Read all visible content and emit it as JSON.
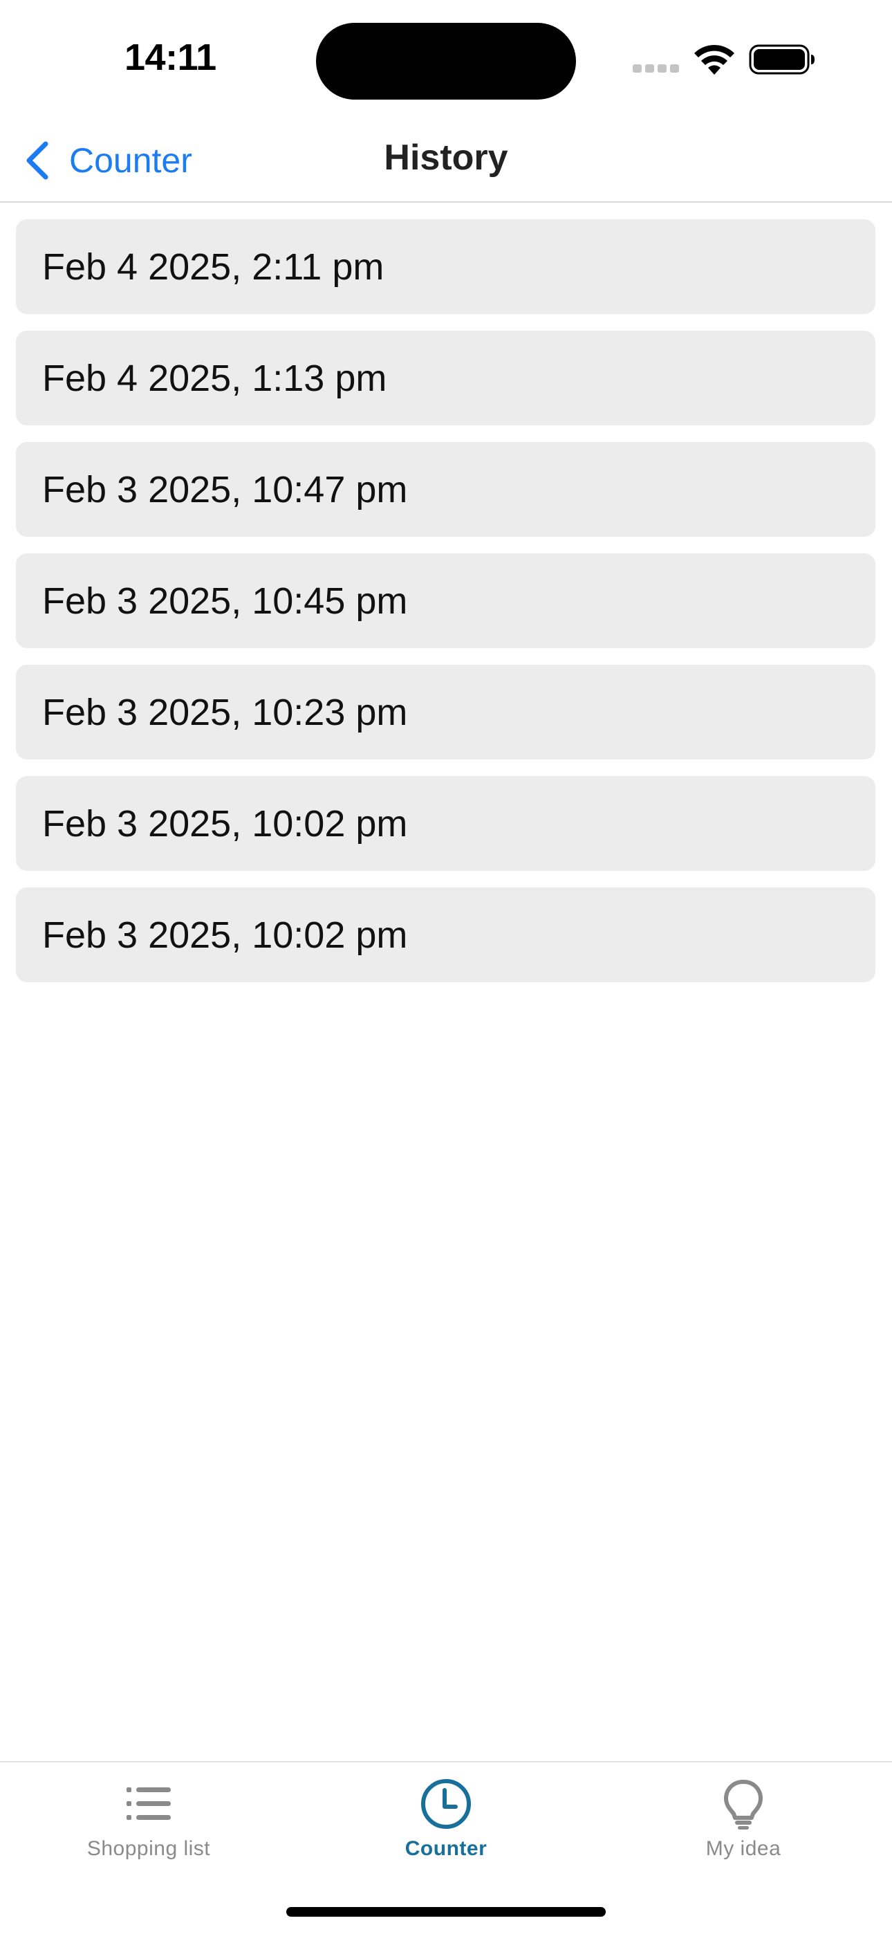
{
  "status_bar": {
    "time": "14:11"
  },
  "nav": {
    "back_label": "Counter",
    "title": "History",
    "accent_color": "#1c7cf2"
  },
  "history": {
    "items": [
      {
        "label": "Feb 4 2025, 2:11 pm"
      },
      {
        "label": "Feb 4 2025, 1:13 pm"
      },
      {
        "label": "Feb 3 2025, 10:47 pm"
      },
      {
        "label": "Feb 3 2025, 10:45 pm"
      },
      {
        "label": "Feb 3 2025, 10:23 pm"
      },
      {
        "label": "Feb 3 2025, 10:02 pm"
      },
      {
        "label": "Feb 3 2025, 10:02 pm"
      }
    ]
  },
  "tab_bar": {
    "active_color": "#176f9a",
    "inactive_color": "#8a8a8a",
    "tabs": [
      {
        "label": "Shopping list",
        "icon": "list-icon",
        "active": false
      },
      {
        "label": "Counter",
        "icon": "clock-icon",
        "active": true
      },
      {
        "label": "My idea",
        "icon": "lightbulb-icon",
        "active": false
      }
    ]
  }
}
